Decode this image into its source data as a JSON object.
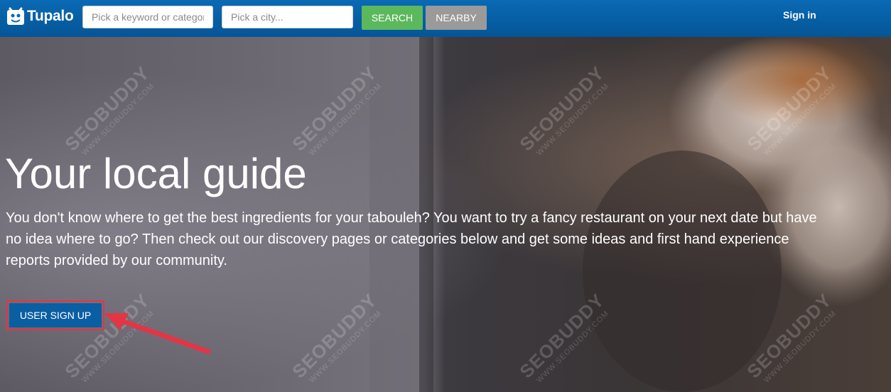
{
  "header": {
    "logo_text": "Tupalo",
    "keyword_placeholder": "Pick a keyword or category",
    "city_placeholder": "Pick a city...",
    "search_label": "SEARCH",
    "nearby_label": "NEARBY",
    "signin_label": "Sign in"
  },
  "hero": {
    "title": "Your local guide",
    "text": "You don't know where to get the best ingredients for your tabouleh? You want to try a fancy restaurant on your next date but have no idea where to go? Then check out our discovery pages or categories below and get some ideas and first hand experience reports provided by our community.",
    "signup_label": "USER SIGN UP"
  },
  "watermark": {
    "text": "SEOBUDDY",
    "url": "WWW.SEOBUDDY.COM"
  },
  "colors": {
    "header_bg": "#045596",
    "search_button": "#5cb85c",
    "nearby_button": "#9a9a9a",
    "signup_button": "#0a5ea2",
    "highlight": "#e53443"
  }
}
